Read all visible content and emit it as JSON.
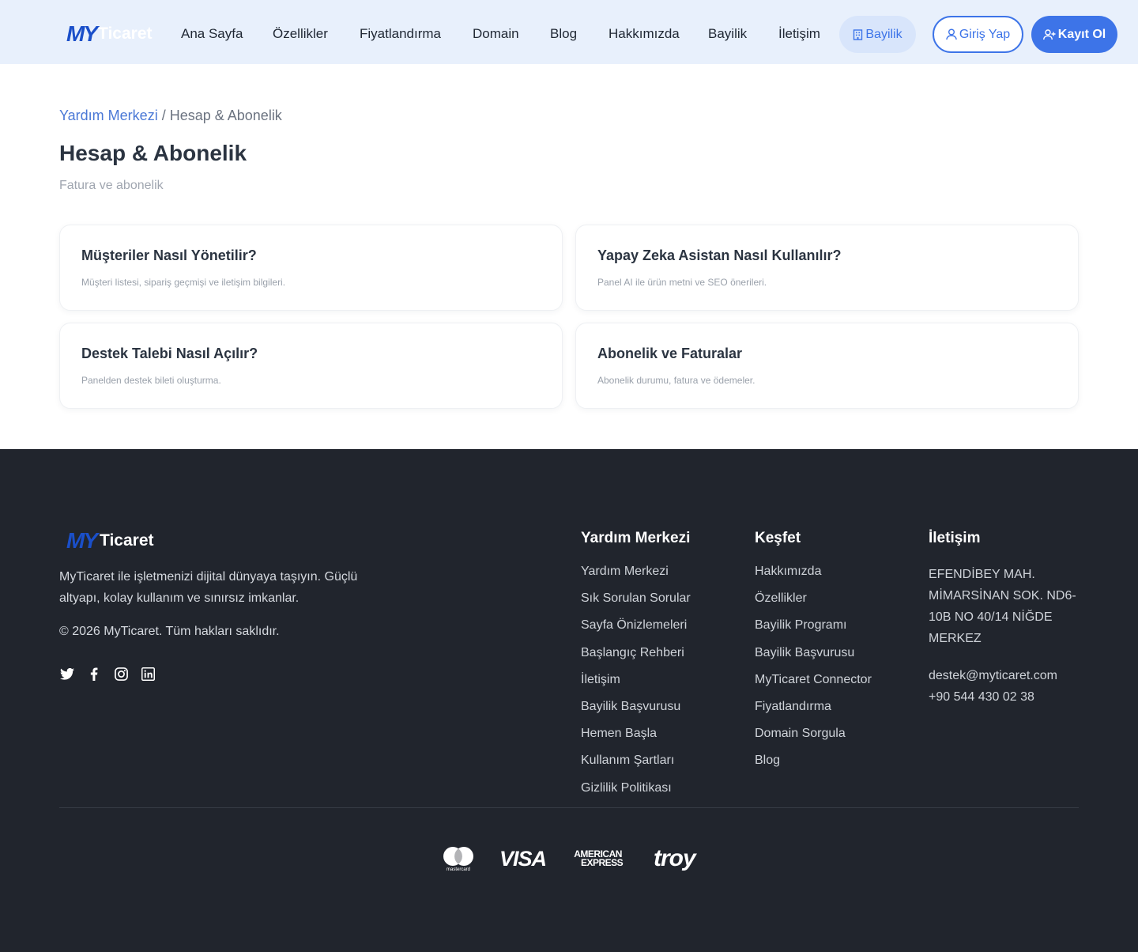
{
  "brand": {
    "my": "MY",
    "ticaret": "Ticaret"
  },
  "nav": {
    "items": [
      "Ana Sayfa",
      "Özellikler",
      "Fiyatlandırma",
      "Domain",
      "Blog",
      "Hakkımızda",
      "Bayilik",
      "İletişim"
    ],
    "bayilik_button": "Bayilik",
    "login_button": "Giriş Yap",
    "register_button": "Kayıt Ol"
  },
  "breadcrumb": {
    "root": "Yardım Merkezi",
    "separator": " / ",
    "current": "Hesap & Abonelik"
  },
  "page": {
    "title": "Hesap & Abonelik",
    "subtitle": "Fatura ve abonelik"
  },
  "cards": [
    {
      "title": "Müşteriler Nasıl Yönetilir?",
      "desc": "Müşteri listesi, sipariş geçmişi ve iletişim bilgileri."
    },
    {
      "title": "Yapay Zeka Asistan Nasıl Kullanılır?",
      "desc": "Panel AI ile ürün metni ve SEO önerileri."
    },
    {
      "title": "Destek Talebi Nasıl Açılır?",
      "desc": "Panelden destek bileti oluşturma."
    },
    {
      "title": "Abonelik ve Faturalar",
      "desc": "Abonelik durumu, fatura ve ödemeler."
    }
  ],
  "footer": {
    "about": "MyTicaret ile işletmenizi dijital dünyaya taşıyın. Güçlü altyapı, kolay kullanım ve sınırsız imkanlar.",
    "copyright": "© 2026 MyTicaret. Tüm hakları saklıdır.",
    "socials": [
      "twitter-icon",
      "facebook-icon",
      "instagram-icon",
      "linkedin-icon"
    ],
    "help": {
      "title": "Yardım Merkezi",
      "links": [
        "Yardım Merkezi",
        "Sık Sorulan Sorular",
        "Sayfa Önizlemeleri",
        "Başlangıç Rehberi",
        "İletişim",
        "Bayilik Başvurusu",
        "Hemen Başla",
        "Kullanım Şartları",
        "Gizlilik Politikası"
      ]
    },
    "discover": {
      "title": "Keşfet",
      "links": [
        "Hakkımızda",
        "Özellikler",
        "Bayilik Programı",
        "Bayilik Başvurusu",
        "MyTicaret Connector",
        "Fiyatlandırma",
        "Domain Sorgula",
        "Blog"
      ]
    },
    "contact": {
      "title": "İletişim",
      "address": "EFENDİBEY MAH. MİMARSİNAN SOK. ND6-10B NO 40/14 NİĞDE MERKEZ",
      "email": "destek@myticaret.com",
      "phone": "+90 544 430 02 38"
    },
    "payments": {
      "visa": "VISA",
      "amex_line1": "AMERICAN",
      "amex_line2": "EXPRESS",
      "troy": "troy",
      "mastercard": "mastercard"
    }
  },
  "colors": {
    "accent": "#3d74e8",
    "header_bg": "#e8f0fc",
    "footer_bg": "#21252d",
    "logo_blue": "#1a4fc9"
  }
}
